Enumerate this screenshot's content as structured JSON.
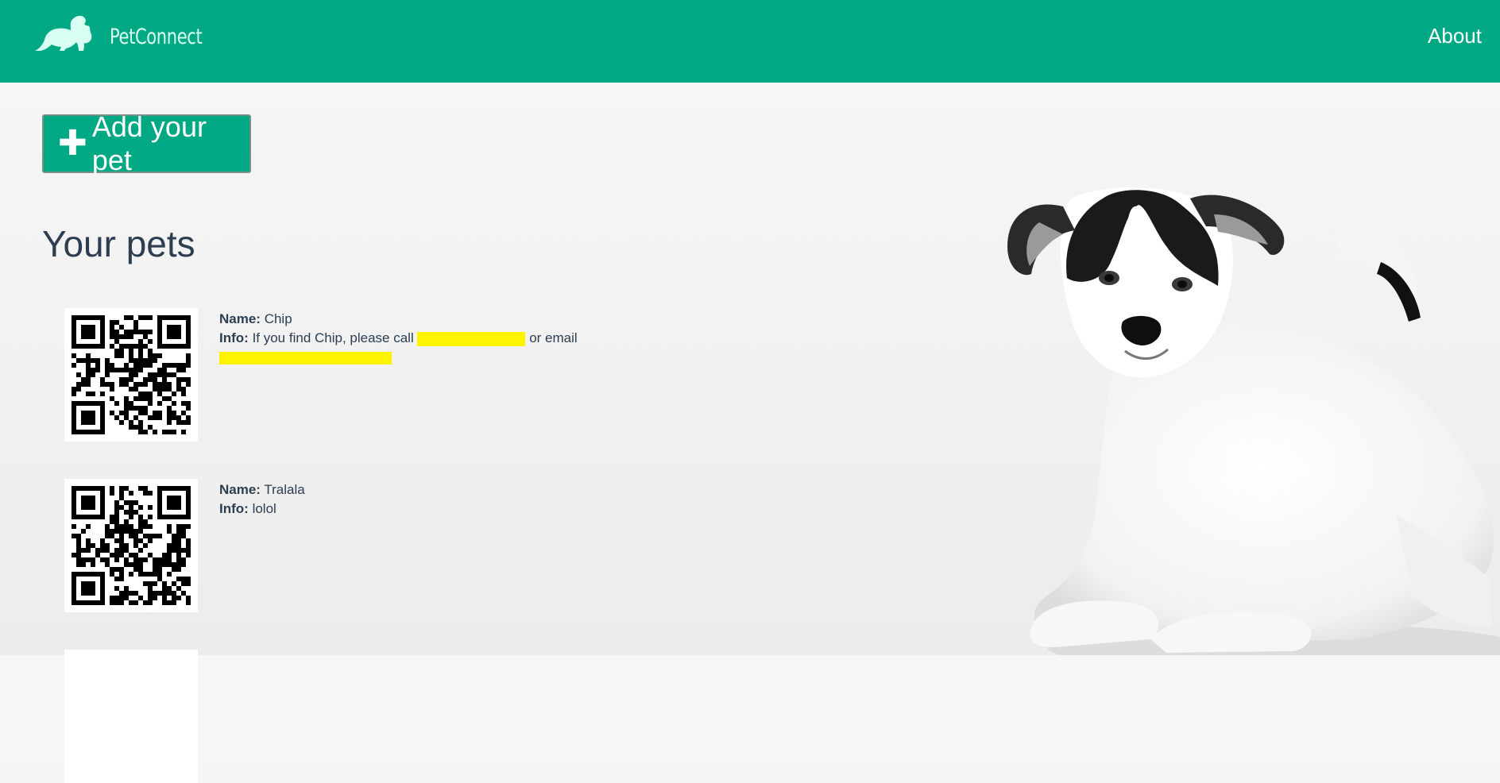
{
  "header": {
    "brand": "PetConnect",
    "nav_about": "About",
    "colors": {
      "primary": "#00a884",
      "brand_text": "#d9fff3"
    }
  },
  "main": {
    "add_button": {
      "icon": "plus-icon",
      "label": "Add your pet"
    },
    "title": "Your pets",
    "pets": [
      {
        "name_label": "Name:",
        "name": "Chip",
        "info_label": "Info:",
        "info_prefix": "If you find Chip, please call",
        "info_mid": "or email"
      },
      {
        "name_label": "Name:",
        "name": "Tralala",
        "info_label": "Info:",
        "info": "lolol"
      }
    ]
  }
}
